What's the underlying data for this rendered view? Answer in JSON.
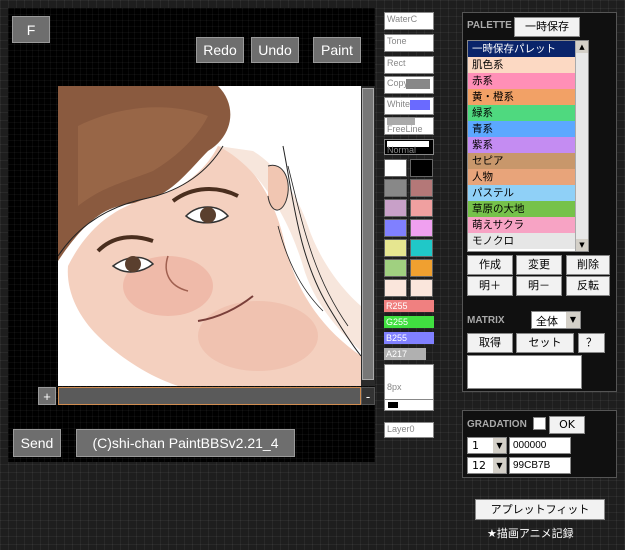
{
  "paint": {
    "f_label": "F",
    "redo": "Redo",
    "undo": "Undo",
    "paint": "Paint",
    "send": "Send",
    "copyright": "(C)shi-chan PaintBBSv2.21_4",
    "zoom_plus": "+",
    "zoom_minus": "-"
  },
  "tools": {
    "waterc": "WaterC",
    "tone": "Tone",
    "rect": "Rect",
    "copy": "Copy",
    "white": "White",
    "freeline": "FreeLine",
    "normal": "Normal",
    "r": "R255",
    "g": "G255",
    "b": "B255",
    "a": "A217",
    "size": "8px",
    "layer": "Layer0"
  },
  "colors": {
    "swatches": [
      "#ffffff",
      "#000000",
      "#888888",
      "#b47878",
      "#c8a0c8",
      "#f0a0a0",
      "#8080ff",
      "#f0a0f0",
      "#e6e690",
      "#20c8c8",
      "#a0d080",
      "#f0a030",
      "#fae6dc",
      "#fae6dc"
    ],
    "r_bar": "#f08080",
    "g_bar": "#40e040",
    "b_bar": "#8080ff",
    "a_bar": "#b0b0b0"
  },
  "palette": {
    "title": "PALETTE",
    "save_btn": "一時保存",
    "items": [
      {
        "label": "一時保存パレット",
        "color": "#0a246a",
        "text": "#ffffff"
      },
      {
        "label": "肌色系",
        "color": "#fcd9c3",
        "text": "#000000"
      },
      {
        "label": "赤系",
        "color": "#ff8fb7",
        "text": "#000000"
      },
      {
        "label": "黄・橙系",
        "color": "#f2a166",
        "text": "#000000"
      },
      {
        "label": "緑系",
        "color": "#4fd97f",
        "text": "#000000"
      },
      {
        "label": "青系",
        "color": "#5ca8ff",
        "text": "#000000"
      },
      {
        "label": "紫系",
        "color": "#c48cf2",
        "text": "#000000"
      },
      {
        "label": "セピア",
        "color": "#c8976b",
        "text": "#000000"
      },
      {
        "label": "人物",
        "color": "#e8a47a",
        "text": "#000000"
      },
      {
        "label": "パステル",
        "color": "#8fd0f7",
        "text": "#000000"
      },
      {
        "label": "草原の大地",
        "color": "#76c24a",
        "text": "#000000"
      },
      {
        "label": "萌えサクラ",
        "color": "#f7a3c4",
        "text": "#000000"
      },
      {
        "label": "モノクロ",
        "color": "#e6e6e6",
        "text": "#000000"
      }
    ],
    "make": "作成",
    "change": "変更",
    "delete": "削除",
    "bright_plus": "明＋",
    "bright_minus": "明－",
    "invert": "反転"
  },
  "matrix": {
    "title": "MATRIX",
    "select_value": "全体",
    "get": "取得",
    "set": "セット",
    "help": "？"
  },
  "gradation": {
    "title": "GRADATION",
    "ok": "OK",
    "row1_num": "1",
    "row1_hex": "000000",
    "row2_num": "12",
    "row2_hex": "99CB7B"
  },
  "footer": {
    "fit_btn": "アプレットフィット",
    "anim_link": "★描画アニメ記録"
  }
}
